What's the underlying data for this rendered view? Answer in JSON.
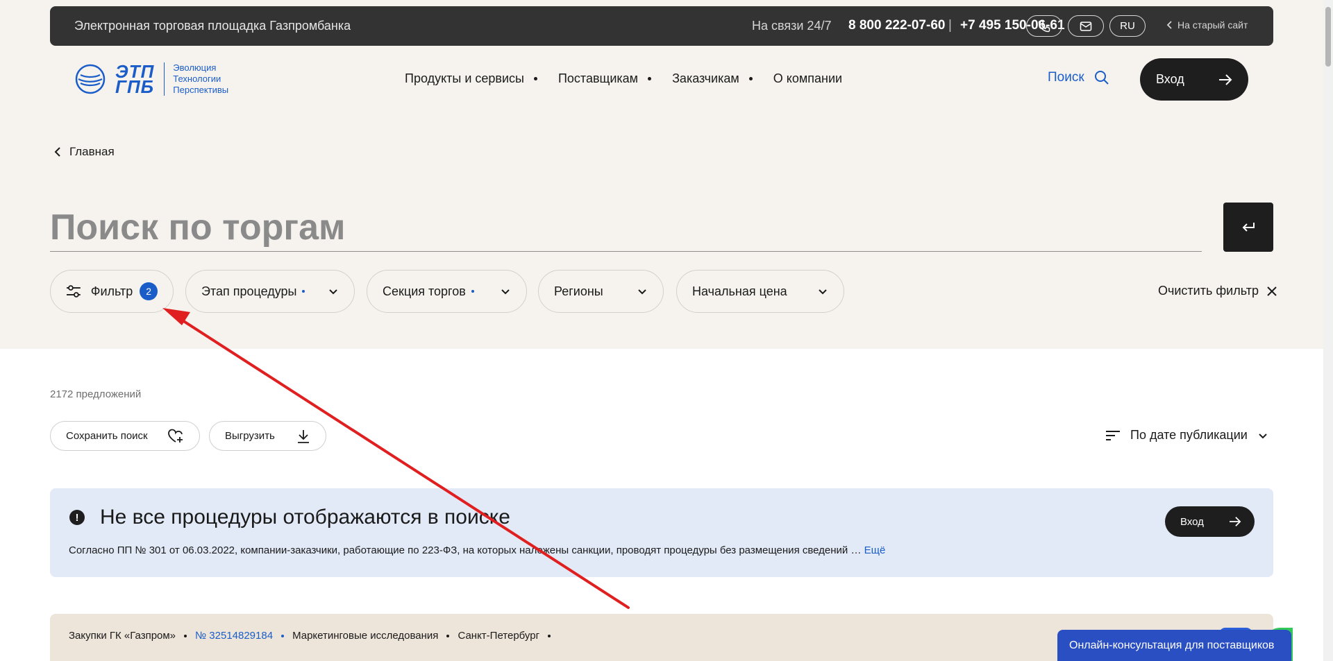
{
  "topbar": {
    "title": "Электронная торговая площадка Газпромбанка",
    "support": "На связи 24/7",
    "phone1": "8 800 222-07-60",
    "separator": "|",
    "phone2": "+7 495 150-06-61",
    "lang": "RU",
    "old_site": "На старый сайт"
  },
  "logo": {
    "mark_line1": "ЭТП",
    "mark_line2": "ГПБ",
    "tagline": [
      "Эволюция",
      "Технологии",
      "Перспективы"
    ]
  },
  "nav": {
    "items": [
      {
        "label": "Продукты и сервисы"
      },
      {
        "label": "Поставщикам"
      },
      {
        "label": "Заказчикам"
      },
      {
        "label": "О компании"
      }
    ],
    "search_label": "Поиск",
    "login_label": "Вход"
  },
  "breadcrumb": {
    "back_label": "Главная"
  },
  "search": {
    "placeholder": "Поиск по торгам",
    "value": ""
  },
  "filters": {
    "filter_label": "Фильтр",
    "filter_count": "2",
    "chips": [
      {
        "label": "Этап процедуры"
      },
      {
        "label": "Секция торгов"
      },
      {
        "label": "Регионы"
      },
      {
        "label": "Начальная цена"
      }
    ],
    "clear_label": "Очистить фильтр"
  },
  "results": {
    "count": "2172 предложений",
    "save_search": "Сохранить поиск",
    "export": "Выгрузить",
    "sort_label": "По дате публикации"
  },
  "notice": {
    "title": "Не все процедуры отображаются в поиске",
    "body": "Согласно ПП № 301 от 06.03.2022, компании-заказчики, работающие по 223-ФЗ, на которых наложены санкции, проводят процедуры без размещения сведений …",
    "more": "Ещё",
    "login_label": "Вход"
  },
  "card": {
    "section": "Закупки ГК «Газпром»",
    "number": "№ 32514829184",
    "category": "Маркетинговые исследования",
    "city": "Санкт-Петербург"
  },
  "consult": {
    "label": "Онлайн-консультация для поставщиков"
  },
  "colors": {
    "accent_blue": "#1a5dc8",
    "dark": "#1e1e1e",
    "hero_bg": "#f6f3ef",
    "notice_bg": "#e2eaf7",
    "annotation_arrow": "#e02020"
  }
}
